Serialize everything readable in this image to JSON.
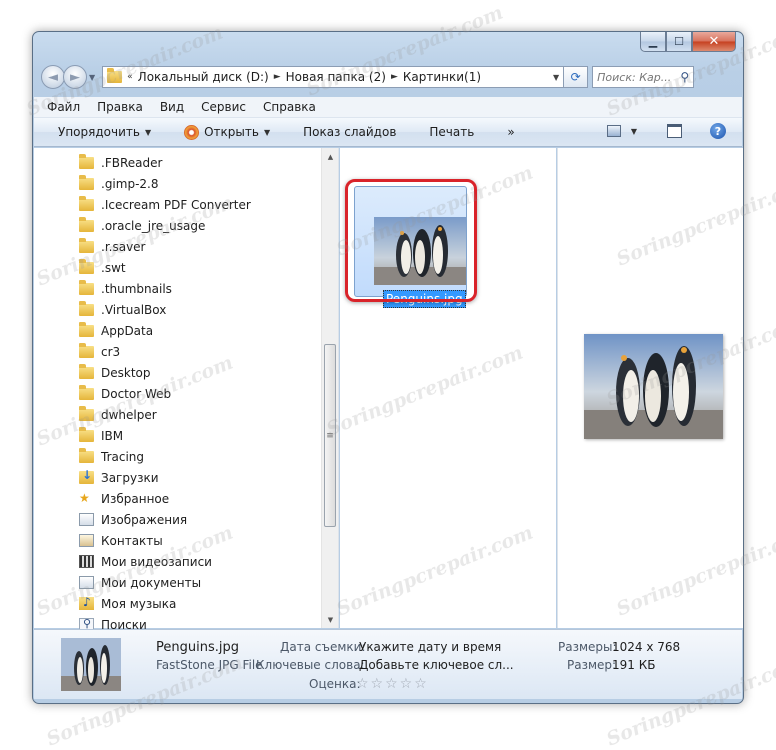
{
  "window": {
    "caption": {
      "minimize": "▁",
      "maximize": "☐",
      "close": "✕"
    }
  },
  "nav": {
    "back": "◄",
    "forward": "►",
    "history": "▼",
    "crumb_root": "«",
    "crumbs": [
      "Локальный диск (D:)",
      "Новая папка (2)",
      "Картинки(1)"
    ],
    "crumb_separator": "►",
    "address_drop": "▼",
    "refresh": "⟳",
    "search_placeholder": "Поиск: Кар...",
    "search_icon": "⚲"
  },
  "menu": [
    "Файл",
    "Правка",
    "Вид",
    "Сервис",
    "Справка"
  ],
  "toolbar": {
    "organize": "Упорядочить",
    "open": "Открыть",
    "slideshow": "Показ слайдов",
    "print": "Печать",
    "more": "»",
    "dropdown": "▼",
    "help": "?"
  },
  "tree": [
    {
      "label": ".FBReader",
      "icon": "folder"
    },
    {
      "label": ".gimp-2.8",
      "icon": "folder"
    },
    {
      "label": ".Icecream PDF Converter",
      "icon": "folder"
    },
    {
      "label": ".oracle_jre_usage",
      "icon": "folder"
    },
    {
      "label": ".r.saver",
      "icon": "folder"
    },
    {
      "label": ".swt",
      "icon": "folder"
    },
    {
      "label": ".thumbnails",
      "icon": "folder"
    },
    {
      "label": ".VirtualBox",
      "icon": "folder"
    },
    {
      "label": "AppData",
      "icon": "folder"
    },
    {
      "label": "cr3",
      "icon": "folder"
    },
    {
      "label": "Desktop",
      "icon": "folder"
    },
    {
      "label": "Doctor Web",
      "icon": "folder"
    },
    {
      "label": "dwhelper",
      "icon": "folder"
    },
    {
      "label": "IBM",
      "icon": "folder"
    },
    {
      "label": "Tracing",
      "icon": "folder"
    },
    {
      "label": "Загрузки",
      "icon": "downloads"
    },
    {
      "label": "Избранное",
      "icon": "favorites"
    },
    {
      "label": "Изображения",
      "icon": "pictures"
    },
    {
      "label": "Контакты",
      "icon": "contacts"
    },
    {
      "label": "Мои видеозаписи",
      "icon": "videos"
    },
    {
      "label": "Мои документы",
      "icon": "documents"
    },
    {
      "label": "Моя музыка",
      "icon": "music"
    },
    {
      "label": "Поиски",
      "icon": "searches"
    }
  ],
  "scrollbar": {
    "up": "▲",
    "down": "▼",
    "grip": "≡"
  },
  "file": {
    "name": "Penguins.jpg"
  },
  "details": {
    "name": "Penguins.jpg",
    "type": "FastStone JPG File",
    "date_label": "Дата съемки:",
    "date_value": "Укажите дату и время",
    "keywords_label": "Ключевые слова:",
    "keywords_value": "Добавьте ключевое сл...",
    "rating_label": "Оценка:",
    "stars": "☆☆☆☆☆",
    "dimensions_label": "Размеры:",
    "dimensions_value": "1024 x 768",
    "size_label": "Размер:",
    "size_value": "191 КБ"
  },
  "watermark": "Soringpcrepair.com",
  "colors": {
    "highlight": "#d9232a",
    "selection": "#3399ff"
  }
}
